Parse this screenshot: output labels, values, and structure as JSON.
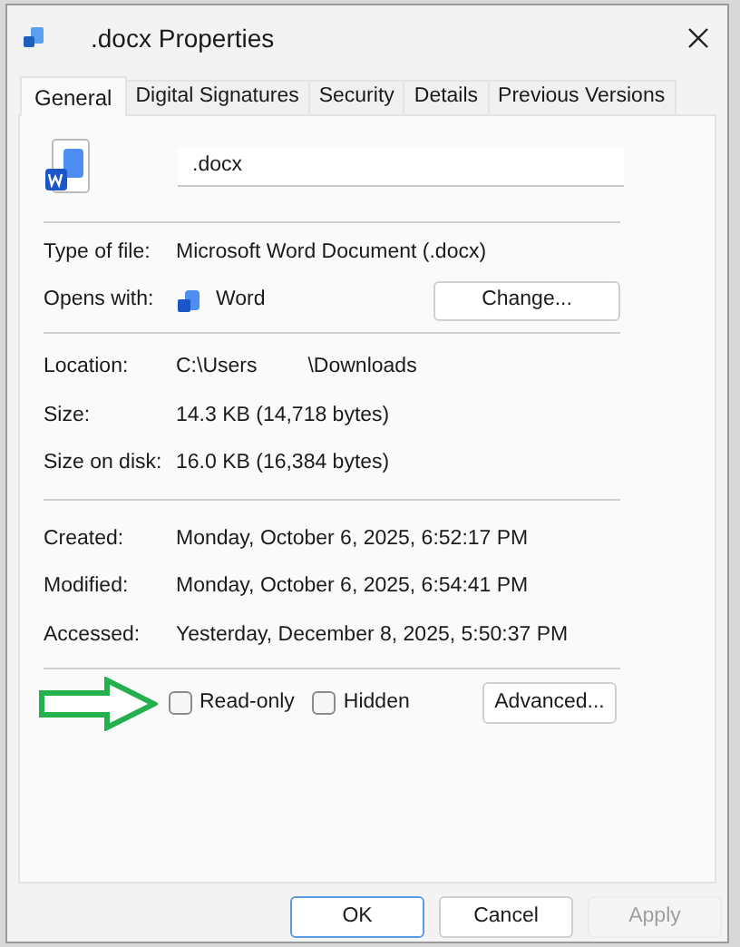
{
  "window": {
    "title": ".docx Properties"
  },
  "tabs": [
    {
      "label": "General",
      "selected": true
    },
    {
      "label": "Digital Signatures",
      "selected": false
    },
    {
      "label": "Security",
      "selected": false
    },
    {
      "label": "Details",
      "selected": false
    },
    {
      "label": "Previous Versions",
      "selected": false
    }
  ],
  "file_name": {
    "value": ".docx"
  },
  "type_of_file": {
    "label": "Type of file:",
    "value": "Microsoft Word Document (.docx)"
  },
  "opens_with": {
    "label": "Opens with:",
    "app": "Word",
    "button": "Change..."
  },
  "location": {
    "label": "Location:",
    "parts": [
      "C:\\Users",
      "\\Downloads"
    ]
  },
  "size_rows": [
    {
      "label": "Size:",
      "value": "14.3 KB (14,718 bytes)"
    },
    {
      "label": "Size on disk:",
      "value": "16.0 KB (16,384 bytes)"
    }
  ],
  "date_rows": [
    {
      "label": "Created:",
      "value": "Monday, October 6, 2025, 6:52:17 PM"
    },
    {
      "label": "Modified:",
      "value": "Monday, October 6, 2025, 6:54:41 PM"
    },
    {
      "label": "Accessed:",
      "value": "Yesterday, December 8, 2025, 5:50:37 PM"
    }
  ],
  "attributes": [
    {
      "label": "Read-only",
      "checked": false
    },
    {
      "label": "Hidden",
      "checked": false
    }
  ],
  "advanced_button": "Advanced...",
  "annotation": {
    "kind": "arrow"
  },
  "buttons": [
    {
      "label": "OK",
      "default": true,
      "disabled": false
    },
    {
      "label": "Cancel",
      "default": false,
      "disabled": false
    },
    {
      "label": "Apply",
      "default": false,
      "disabled": true
    }
  ]
}
